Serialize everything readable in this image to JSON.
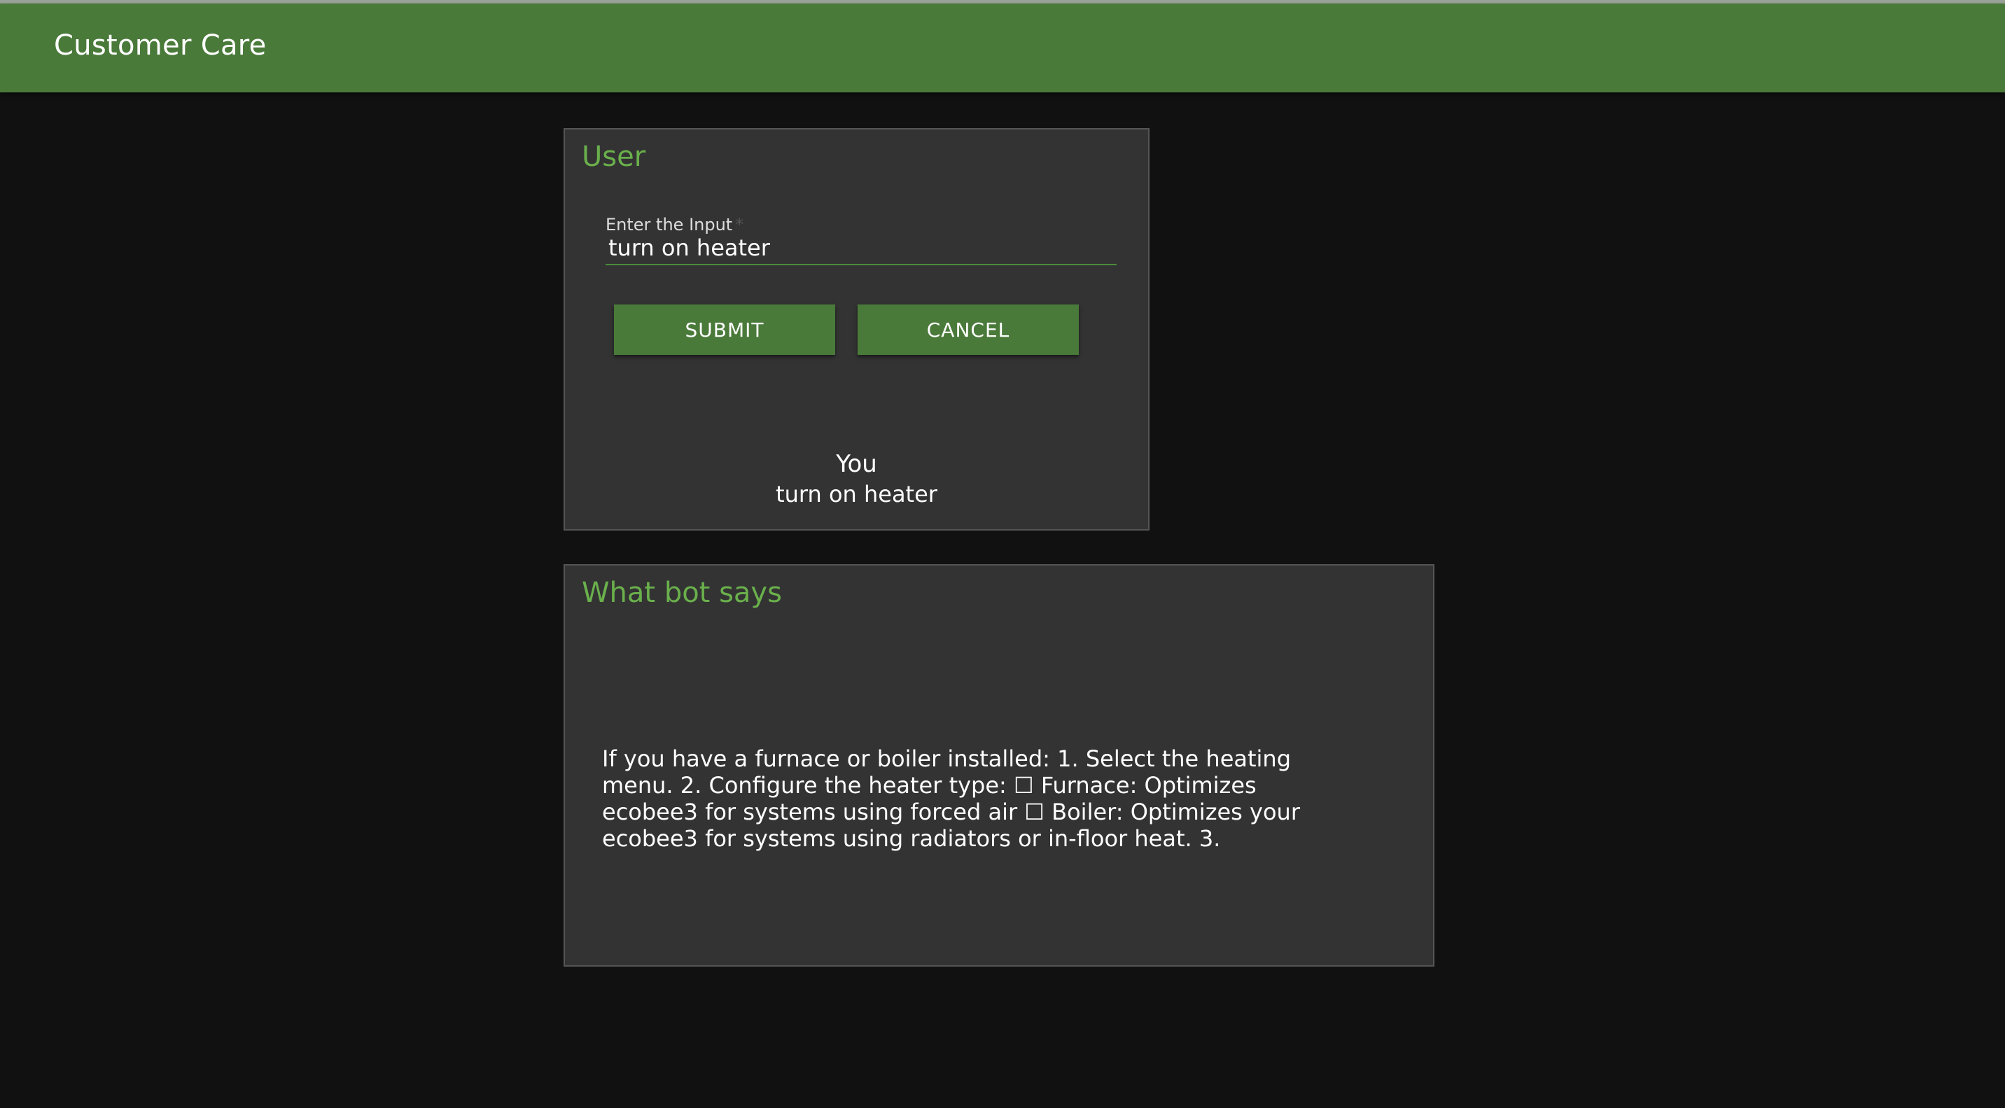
{
  "app": {
    "title": "Customer Care"
  },
  "user_card": {
    "heading": "User",
    "input": {
      "label": "Enter the Input",
      "required_mark": "*",
      "value": "turn on heater"
    },
    "submit_label": "SUBMIT",
    "cancel_label": "CANCEL",
    "last_message": {
      "author": "You",
      "text": "turn on heater"
    }
  },
  "bot_card": {
    "heading": "What bot says",
    "reply": "If you have a furnace or boiler installed: 1. Select the heating menu. 2. Configure the heater type: ☐ Furnace: Optimizes ecobee3 for systems using forced air ☐ Boiler: Optimizes your ecobee3 for systems using radiators or in-floor heat. 3."
  },
  "colors": {
    "appbar": "#4a7a3a",
    "accent_text": "#6ab04c",
    "background": "#111111",
    "card": "#333333"
  }
}
